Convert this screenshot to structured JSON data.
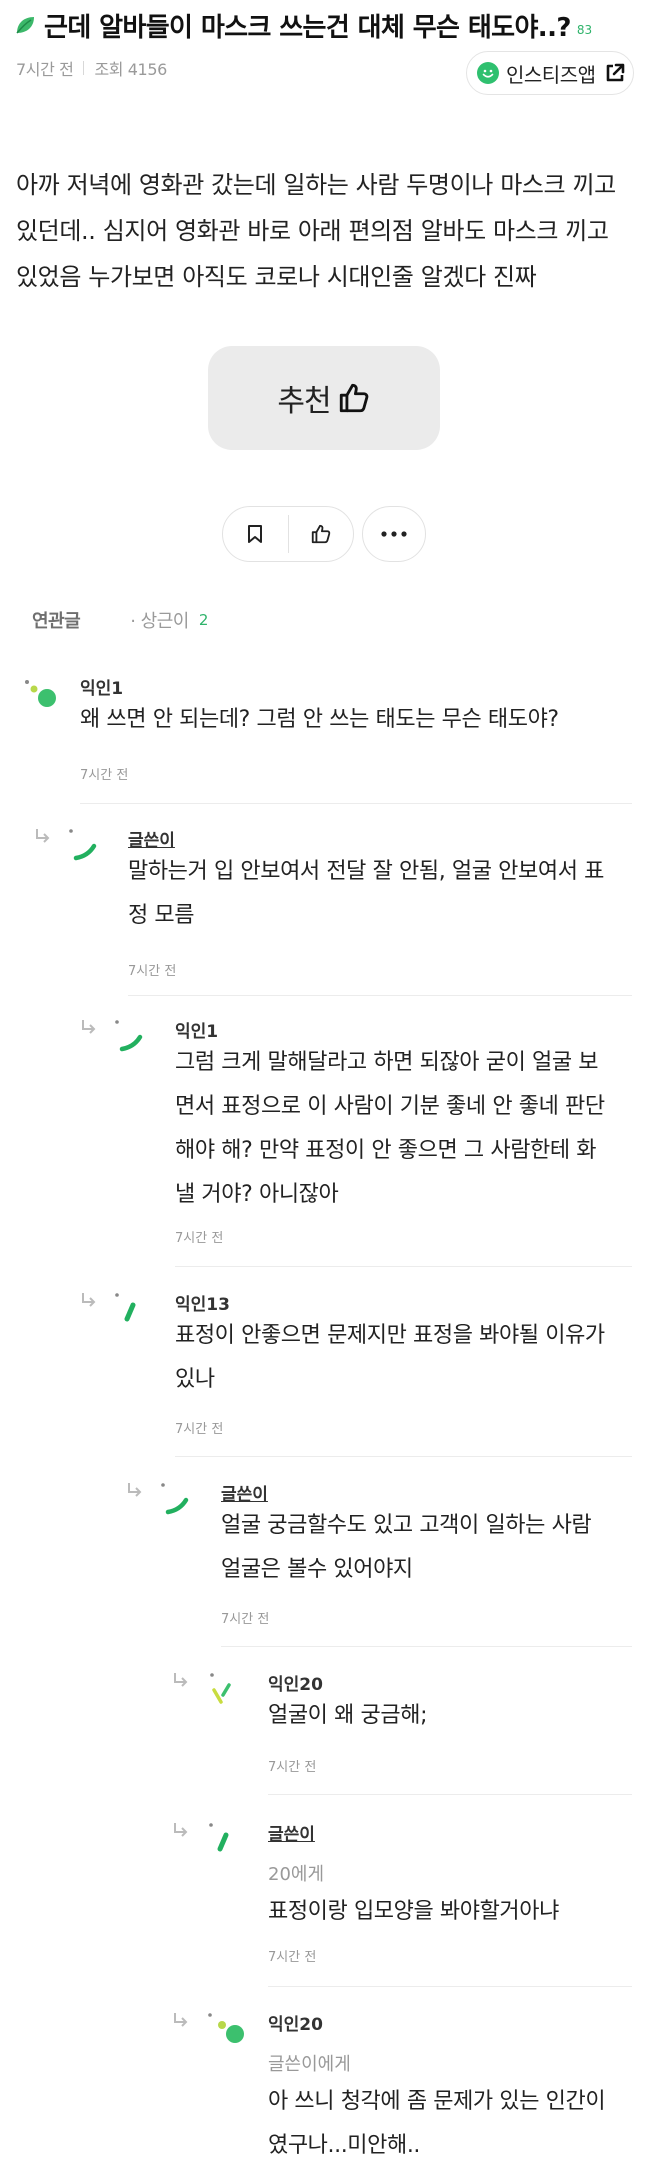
{
  "post": {
    "leaf_icon": "leaf-icon",
    "title": "근데 알바들이 마스크 쓰는건 대체 무슨 태도야..?",
    "comment_count": "83",
    "time": "7시간 전",
    "views": "조회 4156",
    "app_button_label": "인스티즈앱",
    "body_lines": [
      "아까 저녁에 영화관 갔는데 일하는 사람 두명이나 마스크 끼고",
      "있던데.. 심지어 영화관 바로 아래 편의점 알바도 마스크 끼고",
      "있었음 누가보면 아직도 코로나 시대인줄 알겠다 진짜"
    ],
    "recommend_label": "추천"
  },
  "related": {
    "title": "연관글",
    "item": "· 상근이",
    "count": "2"
  },
  "comments": [
    {
      "author": "익인1",
      "text_lines": [
        "왜 쓰면 안 되는데? 그럼 안 쓰는 태도는 무슨 태도야?"
      ],
      "time": "7시간 전"
    },
    {
      "author": "글쓴이",
      "text_lines": [
        "말하는거 입 안보여서 전달 잘 안됨, 얼굴 안보여서 표",
        "정 모름"
      ],
      "time": "7시간 전"
    },
    {
      "author": "익인1",
      "text_lines": [
        "그럼 크게 말해달라고 하면 되잖아 굳이 얼굴 보",
        "면서 표정으로 이 사람이 기분 좋네 안 좋네 판단",
        "해야 해? 만약 표정이 안 좋으면 그 사람한테 화",
        "낼 거야? 아니잖아"
      ],
      "time": "7시간 전"
    },
    {
      "author": "익인13",
      "text_lines": [
        "표정이 안좋으면 문제지만 표정을 봐야될 이유가",
        "있나"
      ],
      "time": "7시간 전"
    },
    {
      "author": "글쓴이",
      "text_lines": [
        "얼굴 궁금할수도 있고 고객이 일하는 사람",
        "얼굴은 볼수 있어야지"
      ],
      "time": "7시간 전"
    },
    {
      "author": "익인20",
      "text_lines": [
        "얼굴이 왜 궁금해;"
      ],
      "time": "7시간 전"
    },
    {
      "author": "글쓴이",
      "target": "20에게",
      "text_lines": [
        "표정이랑 입모양을 봐야할거아냐"
      ],
      "time": "7시간 전"
    },
    {
      "author": "익인20",
      "target": "글쓴이에게",
      "text_lines": [
        "아 쓰니 청각에 좀 문제가 있는 인간이",
        "였구나...미안해.."
      ],
      "time": ""
    }
  ],
  "colors": {
    "accent": "#2fb36b",
    "avatar_green": "#3cc06e",
    "avatar_lime": "#a8d84a"
  }
}
